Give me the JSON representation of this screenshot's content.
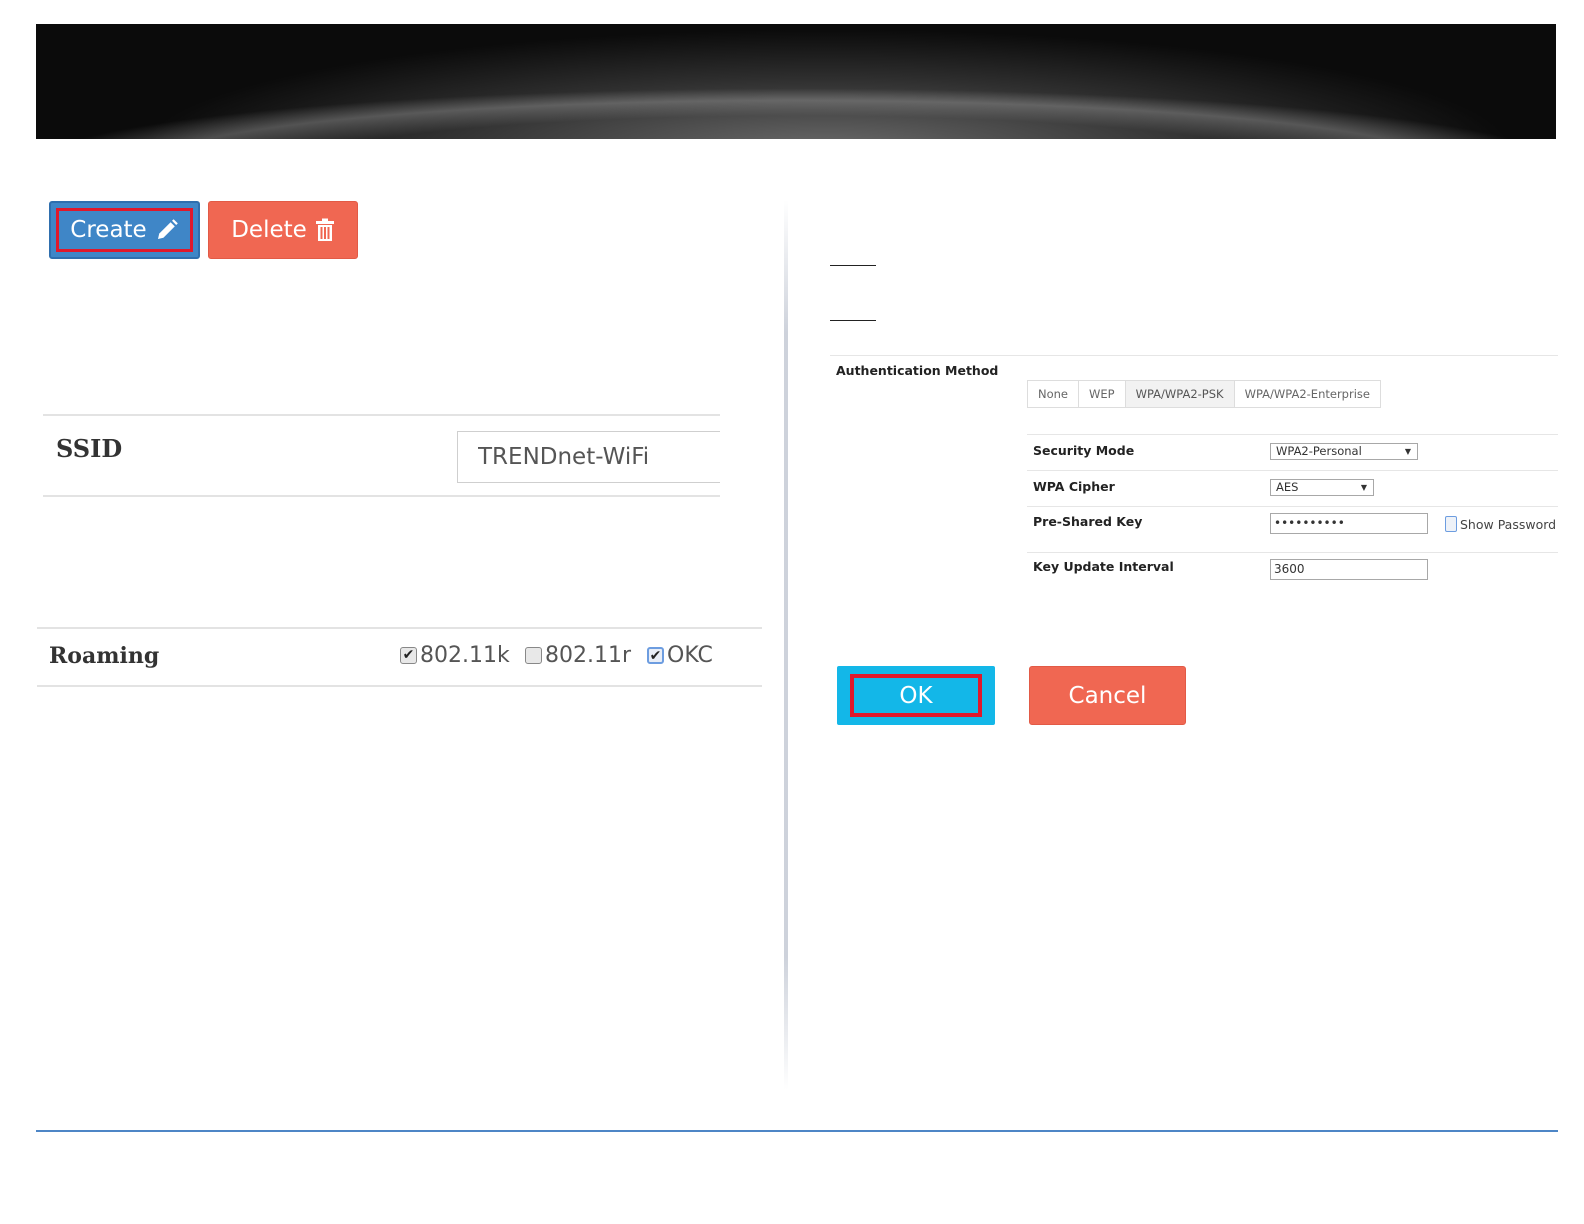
{
  "toolbar": {
    "create_label": "Create",
    "delete_label": "Delete"
  },
  "ssid": {
    "label": "SSID",
    "value": "TRENDnet-WiFi"
  },
  "roaming": {
    "label": "Roaming",
    "options": [
      {
        "label": "802.11k",
        "checked": true
      },
      {
        "label": "802.11r",
        "checked": false
      },
      {
        "label": "OKC",
        "checked": true
      }
    ]
  },
  "security": {
    "auth_method_label": "Authentication Method",
    "tabs": [
      {
        "label": "None",
        "active": false
      },
      {
        "label": "WEP",
        "active": false
      },
      {
        "label": "WPA/WPA2-PSK",
        "active": true
      },
      {
        "label": "WPA/WPA2-Enterprise",
        "active": false
      }
    ],
    "security_mode_label": "Security Mode",
    "security_mode_value": "WPA2-Personal",
    "wpa_cipher_label": "WPA Cipher",
    "wpa_cipher_value": "AES",
    "psk_label": "Pre-Shared Key",
    "psk_value": "••••••••••",
    "show_password_label": "Show Password",
    "show_password_checked": false,
    "key_interval_label": "Key Update Interval",
    "key_interval_value": "3600"
  },
  "dialog": {
    "ok_label": "OK",
    "cancel_label": "Cancel"
  },
  "colors": {
    "create_blue": "#3f86c7",
    "delete_red": "#f06752",
    "ok_cyan": "#13b7e8",
    "highlight_red": "#e0182b",
    "footer_blue": "#4d86c6"
  },
  "icons": {
    "create": "pencil-icon",
    "delete": "trash-icon",
    "select_arrow": "dropdown-arrow-icon"
  }
}
